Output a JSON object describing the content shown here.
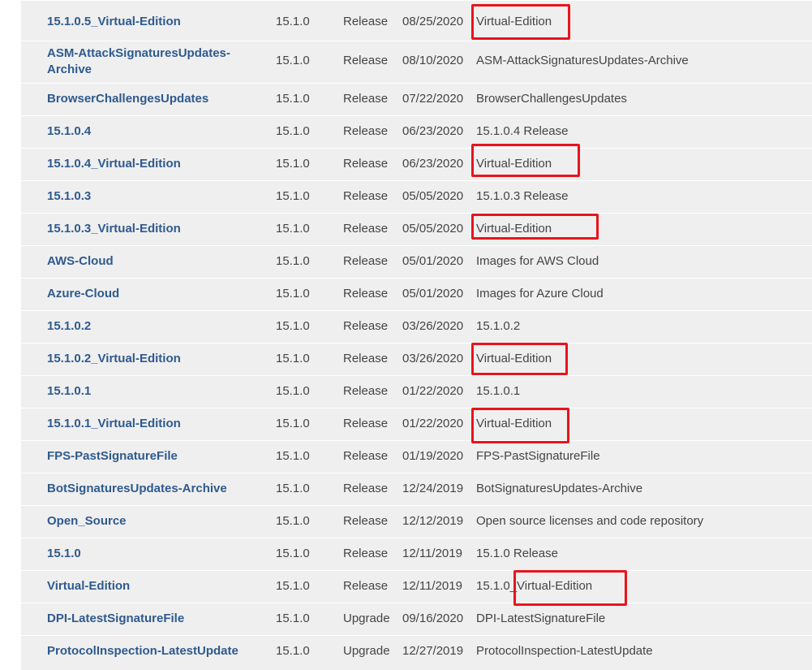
{
  "downloads": {
    "rows": [
      {
        "name": "15.1.0.5_Virtual-Edition",
        "version": "15.1.0",
        "type": "Release",
        "date": "08/25/2020",
        "description": "Virtual-Edition"
      },
      {
        "name": "ASM-AttackSignaturesUpdates-Archive",
        "version": "15.1.0",
        "type": "Release",
        "date": "08/10/2020",
        "description": "ASM-AttackSignaturesUpdates-Archive"
      },
      {
        "name": "BrowserChallengesUpdates",
        "version": "15.1.0",
        "type": "Release",
        "date": "07/22/2020",
        "description": "BrowserChallengesUpdates"
      },
      {
        "name": "15.1.0.4",
        "version": "15.1.0",
        "type": "Release",
        "date": "06/23/2020",
        "description": "15.1.0.4 Release"
      },
      {
        "name": "15.1.0.4_Virtual-Edition",
        "version": "15.1.0",
        "type": "Release",
        "date": "06/23/2020",
        "description": "Virtual-Edition"
      },
      {
        "name": "15.1.0.3",
        "version": "15.1.0",
        "type": "Release",
        "date": "05/05/2020",
        "description": "15.1.0.3 Release"
      },
      {
        "name": "15.1.0.3_Virtual-Edition",
        "version": "15.1.0",
        "type": "Release",
        "date": "05/05/2020",
        "description": "Virtual-Edition"
      },
      {
        "name": "AWS-Cloud",
        "version": "15.1.0",
        "type": "Release",
        "date": "05/01/2020",
        "description": "Images for AWS Cloud"
      },
      {
        "name": "Azure-Cloud",
        "version": "15.1.0",
        "type": "Release",
        "date": "05/01/2020",
        "description": "Images for Azure Cloud"
      },
      {
        "name": "15.1.0.2",
        "version": "15.1.0",
        "type": "Release",
        "date": "03/26/2020",
        "description": "15.1.0.2"
      },
      {
        "name": "15.1.0.2_Virtual-Edition",
        "version": "15.1.0",
        "type": "Release",
        "date": "03/26/2020",
        "description": "Virtual-Edition"
      },
      {
        "name": "15.1.0.1",
        "version": "15.1.0",
        "type": "Release",
        "date": "01/22/2020",
        "description": "15.1.0.1"
      },
      {
        "name": "15.1.0.1_Virtual-Edition",
        "version": "15.1.0",
        "type": "Release",
        "date": "01/22/2020",
        "description": "Virtual-Edition"
      },
      {
        "name": "FPS-PastSignatureFile",
        "version": "15.1.0",
        "type": "Release",
        "date": "01/19/2020",
        "description": "FPS-PastSignatureFile"
      },
      {
        "name": "BotSignaturesUpdates-Archive",
        "version": "15.1.0",
        "type": "Release",
        "date": "12/24/2019",
        "description": "BotSignaturesUpdates-Archive"
      },
      {
        "name": "Open_Source",
        "version": "15.1.0",
        "type": "Release",
        "date": "12/12/2019",
        "description": "Open source licenses and code repository"
      },
      {
        "name": "15.1.0",
        "version": "15.1.0",
        "type": "Release",
        "date": "12/11/2019",
        "description": "15.1.0 Release"
      },
      {
        "name": "Virtual-Edition",
        "version": "15.1.0",
        "type": "Release",
        "date": "12/11/2019",
        "description": "15.1.0_Virtual-Edition"
      },
      {
        "name": "DPI-LatestSignatureFile",
        "version": "15.1.0",
        "type": "Upgrade",
        "date": "09/16/2020",
        "description": "DPI-LatestSignatureFile"
      },
      {
        "name": "ProtocolInspection-LatestUpdate",
        "version": "15.1.0",
        "type": "Upgrade",
        "date": "12/27/2019",
        "description": "ProtocolInspection-LatestUpdate"
      }
    ]
  },
  "colors": {
    "link": "#2f5a8e",
    "highlight": "#e8141c",
    "row_background": "#efefef"
  }
}
